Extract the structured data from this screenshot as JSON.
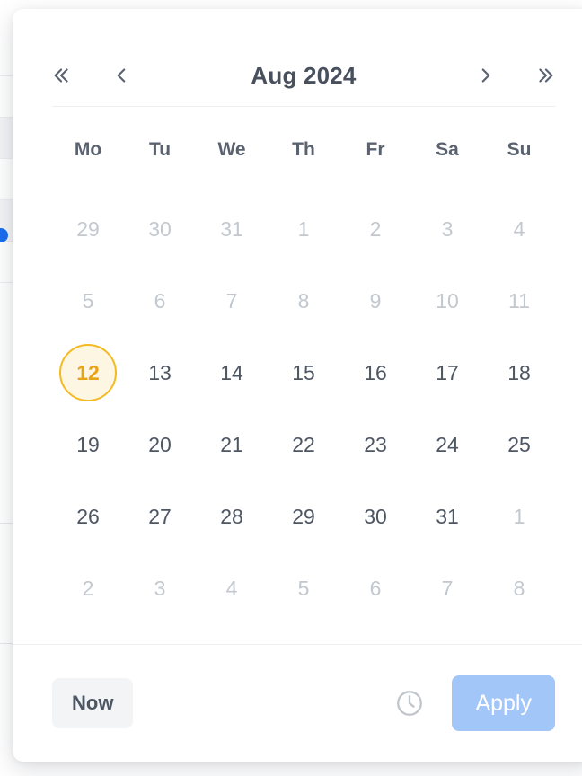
{
  "background": {
    "name": "underlying-table-view",
    "accent_color": "#1668e3",
    "row_divider_color": "#ebedf0",
    "striped_row_color": "#f2f4f7",
    "scrollbar_color": "#1668e3"
  },
  "popup": {
    "name": "date-time-picker",
    "background_color": "#ffffff"
  },
  "header": {
    "prev_year_icon": "chevron-double-left-icon",
    "prev_month_icon": "chevron-left-icon",
    "title": "Aug 2024",
    "next_month_icon": "chevron-right-icon",
    "next_year_icon": "chevron-double-right-icon"
  },
  "calendar": {
    "weekdays": [
      "Mo",
      "Tu",
      "We",
      "Th",
      "Fr",
      "Sa",
      "Su"
    ],
    "selected_day": "12",
    "selected_color": "#f5b921",
    "selected_fill": "#fdf6e3",
    "active_color": "#4d5663",
    "muted_color": "#c3c8d0",
    "weeks": [
      [
        {
          "label": "29",
          "state": "muted"
        },
        {
          "label": "30",
          "state": "muted"
        },
        {
          "label": "31",
          "state": "muted"
        },
        {
          "label": "1",
          "state": "muted"
        },
        {
          "label": "2",
          "state": "muted"
        },
        {
          "label": "3",
          "state": "muted"
        },
        {
          "label": "4",
          "state": "muted"
        }
      ],
      [
        {
          "label": "5",
          "state": "muted"
        },
        {
          "label": "6",
          "state": "muted"
        },
        {
          "label": "7",
          "state": "muted"
        },
        {
          "label": "8",
          "state": "muted"
        },
        {
          "label": "9",
          "state": "muted"
        },
        {
          "label": "10",
          "state": "muted"
        },
        {
          "label": "11",
          "state": "muted"
        }
      ],
      [
        {
          "label": "12",
          "state": "selected"
        },
        {
          "label": "13",
          "state": "active"
        },
        {
          "label": "14",
          "state": "active"
        },
        {
          "label": "15",
          "state": "active"
        },
        {
          "label": "16",
          "state": "active"
        },
        {
          "label": "17",
          "state": "active"
        },
        {
          "label": "18",
          "state": "active"
        }
      ],
      [
        {
          "label": "19",
          "state": "active"
        },
        {
          "label": "20",
          "state": "active"
        },
        {
          "label": "21",
          "state": "active"
        },
        {
          "label": "22",
          "state": "active"
        },
        {
          "label": "23",
          "state": "active"
        },
        {
          "label": "24",
          "state": "active"
        },
        {
          "label": "25",
          "state": "active"
        }
      ],
      [
        {
          "label": "26",
          "state": "active"
        },
        {
          "label": "27",
          "state": "active"
        },
        {
          "label": "28",
          "state": "active"
        },
        {
          "label": "29",
          "state": "active"
        },
        {
          "label": "30",
          "state": "active"
        },
        {
          "label": "31",
          "state": "active"
        },
        {
          "label": "1",
          "state": "muted"
        }
      ],
      [
        {
          "label": "2",
          "state": "muted"
        },
        {
          "label": "3",
          "state": "muted"
        },
        {
          "label": "4",
          "state": "muted"
        },
        {
          "label": "5",
          "state": "muted"
        },
        {
          "label": "6",
          "state": "muted"
        },
        {
          "label": "7",
          "state": "muted"
        },
        {
          "label": "8",
          "state": "muted"
        }
      ]
    ]
  },
  "footer": {
    "now_label": "Now",
    "clock_icon": "clock-icon",
    "apply_label": "Apply",
    "apply_color": "#a3c6f9"
  }
}
